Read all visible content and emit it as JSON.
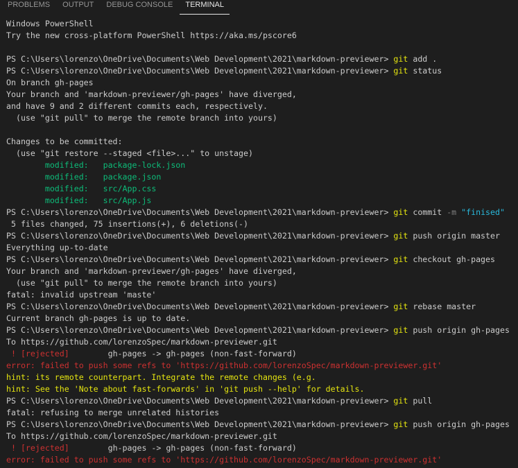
{
  "tabs": [
    {
      "label": "PROBLEMS",
      "active": false
    },
    {
      "label": "OUTPUT",
      "active": false
    },
    {
      "label": "DEBUG CONSOLE",
      "active": false
    },
    {
      "label": "TERMINAL",
      "active": true
    }
  ],
  "colors": {
    "background": "#1e1e1e",
    "text": "#cccccc",
    "command": "#e5e510",
    "string": "#29b8db",
    "modified": "#0dbc79",
    "error": "#cd3131",
    "hint": "#e5e510",
    "flag": "#808080"
  },
  "terminal": {
    "lines": [
      [
        {
          "t": "Windows PowerShell",
          "c": "plain"
        }
      ],
      [
        {
          "t": "Try the new cross-platform PowerShell https://aka.ms/pscore6",
          "c": "plain"
        }
      ],
      [],
      [
        {
          "t": "PS C:\\Users\\lorenzo\\OneDrive\\Documents\\Web Development\\2021\\markdown-previewer> ",
          "c": "prompt"
        },
        {
          "t": "git",
          "c": "cmd"
        },
        {
          "t": " add .",
          "c": "args"
        }
      ],
      [
        {
          "t": "PS C:\\Users\\lorenzo\\OneDrive\\Documents\\Web Development\\2021\\markdown-previewer> ",
          "c": "prompt"
        },
        {
          "t": "git",
          "c": "cmd"
        },
        {
          "t": " status",
          "c": "args"
        }
      ],
      [
        {
          "t": "On branch gh-pages",
          "c": "plain"
        }
      ],
      [
        {
          "t": "Your branch and 'markdown-previewer/gh-pages' have diverged,",
          "c": "plain"
        }
      ],
      [
        {
          "t": "and have 9 and 2 different commits each, respectively.",
          "c": "plain"
        }
      ],
      [
        {
          "t": "  (use \"git pull\" to merge the remote branch into yours)",
          "c": "plain"
        }
      ],
      [],
      [
        {
          "t": "Changes to be committed:",
          "c": "plain"
        }
      ],
      [
        {
          "t": "  (use \"git restore --staged <file>...\" to unstage)",
          "c": "plain"
        }
      ],
      [
        {
          "t": "        modified:   package-lock.json",
          "c": "green"
        }
      ],
      [
        {
          "t": "        modified:   package.json",
          "c": "green"
        }
      ],
      [
        {
          "t": "        modified:   src/App.css",
          "c": "green"
        }
      ],
      [
        {
          "t": "        modified:   src/App.js",
          "c": "green"
        }
      ],
      [
        {
          "t": "PS C:\\Users\\lorenzo\\OneDrive\\Documents\\Web Development\\2021\\markdown-previewer> ",
          "c": "prompt"
        },
        {
          "t": "git",
          "c": "cmd"
        },
        {
          "t": " commit ",
          "c": "args"
        },
        {
          "t": "-m",
          "c": "flag"
        },
        {
          "t": " ",
          "c": "args"
        },
        {
          "t": "\"finised\"",
          "c": "str"
        }
      ],
      [
        {
          "t": " 5 files changed, 75 insertions(+), 6 deletions(-)",
          "c": "plain"
        }
      ],
      [
        {
          "t": "PS C:\\Users\\lorenzo\\OneDrive\\Documents\\Web Development\\2021\\markdown-previewer> ",
          "c": "prompt"
        },
        {
          "t": "git",
          "c": "cmd"
        },
        {
          "t": " push origin master",
          "c": "args"
        }
      ],
      [
        {
          "t": "Everything up-to-date",
          "c": "plain"
        }
      ],
      [
        {
          "t": "PS C:\\Users\\lorenzo\\OneDrive\\Documents\\Web Development\\2021\\markdown-previewer> ",
          "c": "prompt"
        },
        {
          "t": "git",
          "c": "cmd"
        },
        {
          "t": " checkout gh-pages",
          "c": "args"
        }
      ],
      [
        {
          "t": "Your branch and 'markdown-previewer/gh-pages' have diverged,",
          "c": "plain"
        }
      ],
      [
        {
          "t": "  (use \"git pull\" to merge the remote branch into yours)",
          "c": "plain"
        }
      ],
      [
        {
          "t": "fatal: invalid upstream 'maste'",
          "c": "plain"
        }
      ],
      [
        {
          "t": "PS C:\\Users\\lorenzo\\OneDrive\\Documents\\Web Development\\2021\\markdown-previewer> ",
          "c": "prompt"
        },
        {
          "t": "git",
          "c": "cmd"
        },
        {
          "t": " rebase master",
          "c": "args"
        }
      ],
      [
        {
          "t": "Current branch gh-pages is up to date.",
          "c": "plain"
        }
      ],
      [
        {
          "t": "PS C:\\Users\\lorenzo\\OneDrive\\Documents\\Web Development\\2021\\markdown-previewer> ",
          "c": "prompt"
        },
        {
          "t": "git",
          "c": "cmd"
        },
        {
          "t": " push origin gh-pages",
          "c": "args"
        }
      ],
      [
        {
          "t": "To https://github.com/lorenzoSpec/markdown-previewer.git",
          "c": "plain"
        }
      ],
      [
        {
          "t": " ! [rejected]",
          "c": "red"
        },
        {
          "t": "        gh-pages -> gh-pages (non-fast-forward)",
          "c": "plain"
        }
      ],
      [
        {
          "t": "error: failed to push some refs to 'https://github.com/lorenzoSpec/markdown-previewer.git'",
          "c": "red"
        }
      ],
      [
        {
          "t": "hint: its remote counterpart. Integrate the remote changes (e.g.",
          "c": "yellow"
        }
      ],
      [
        {
          "t": "hint: See the 'Note about fast-forwards' in 'git push --help' for details.",
          "c": "yellow"
        }
      ],
      [
        {
          "t": "PS C:\\Users\\lorenzo\\OneDrive\\Documents\\Web Development\\2021\\markdown-previewer> ",
          "c": "prompt"
        },
        {
          "t": "git",
          "c": "cmd"
        },
        {
          "t": " pull",
          "c": "args"
        }
      ],
      [
        {
          "t": "fatal: refusing to merge unrelated histories",
          "c": "plain"
        }
      ],
      [
        {
          "t": "PS C:\\Users\\lorenzo\\OneDrive\\Documents\\Web Development\\2021\\markdown-previewer> ",
          "c": "prompt"
        },
        {
          "t": "git",
          "c": "cmd"
        },
        {
          "t": " push origin gh-pages",
          "c": "args"
        }
      ],
      [
        {
          "t": "To https://github.com/lorenzoSpec/markdown-previewer.git",
          "c": "plain"
        }
      ],
      [
        {
          "t": " ! [rejected]",
          "c": "red"
        },
        {
          "t": "        gh-pages -> gh-pages (non-fast-forward)",
          "c": "plain"
        }
      ],
      [
        {
          "t": "error: failed to push some refs to 'https://github.com/lorenzoSpec/markdown-previewer.git'",
          "c": "red"
        }
      ]
    ]
  }
}
